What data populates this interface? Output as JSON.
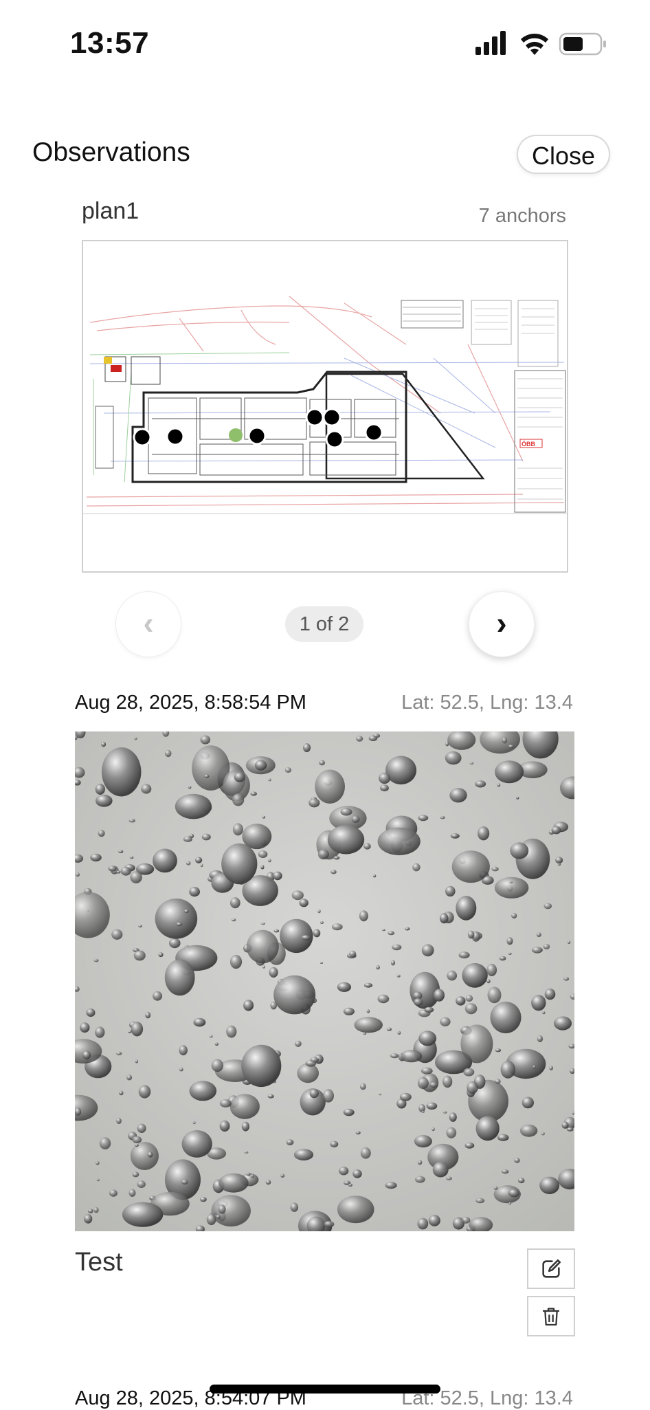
{
  "status_bar": {
    "time": "13:57",
    "icons": [
      "signal-icon",
      "wifi-icon",
      "battery-icon"
    ]
  },
  "header": {
    "title": "Observations",
    "close_label": "Close"
  },
  "plan": {
    "name": "plan1",
    "anchors_label": "7 anchors",
    "pager": {
      "indicator": "1 of 2",
      "prev_icon": "chevron-left-icon",
      "next_icon": "chevron-right-icon",
      "prev_enabled": false,
      "next_enabled": true
    }
  },
  "observations": [
    {
      "timestamp": "Aug 28, 2025, 8:58:54 PM",
      "location": "Lat: 52.5, Lng: 13.4",
      "note": "Test",
      "photo_subject": "water droplets on gray surface",
      "actions": [
        "edit-icon",
        "trash-icon"
      ]
    },
    {
      "timestamp": "Aug 28, 2025, 8:54:07 PM",
      "location": "Lat: 52.5, Lng: 13.4"
    }
  ],
  "colors": {
    "accent": "#111111",
    "border": "#cfcfcf",
    "muted": "#888888",
    "pill": "#ececec"
  }
}
